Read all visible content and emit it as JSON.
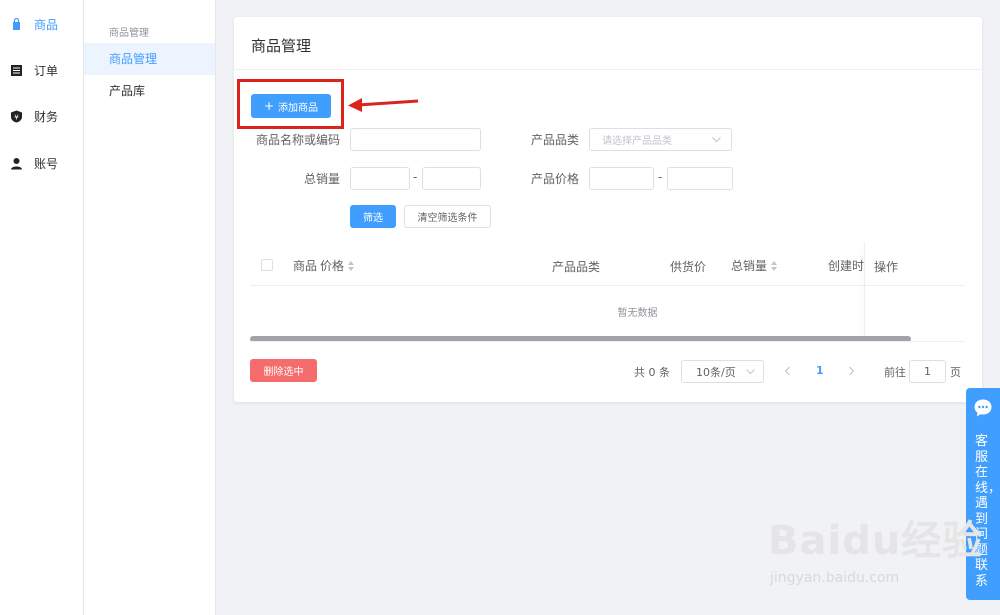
{
  "nav": {
    "items": [
      {
        "label": "商品",
        "icon": "bag-icon"
      },
      {
        "label": "订单",
        "icon": "list-icon"
      },
      {
        "label": "财务",
        "icon": "money-icon"
      },
      {
        "label": "账号",
        "icon": "user-icon"
      }
    ]
  },
  "subnav": {
    "group": "商品管理",
    "items": [
      "商品管理",
      "产品库"
    ]
  },
  "page": {
    "title": "商品管理",
    "add_button": "添加商品"
  },
  "filters": {
    "name_label": "商品名称或编码",
    "name_value": "",
    "category_label": "产品品类",
    "category_placeholder": "请选择产品品类",
    "sales_label": "总销量",
    "price_label": "产品价格",
    "dash": "-",
    "filter_button": "筛选",
    "clear_button": "清空筛选条件"
  },
  "table": {
    "columns": [
      "商品",
      "价格",
      "产品品类",
      "供货价",
      "总销量",
      "创建时间",
      "操作"
    ],
    "empty_text": "暂无数据"
  },
  "footer": {
    "delete_button": "删除选中",
    "total": "共 0 条",
    "page_size": "10条/页",
    "current_page": "1",
    "goto_label": "前往",
    "goto_value": "1",
    "page_suffix": "页"
  },
  "service": {
    "text": "客服在线，遇到问题联系"
  },
  "watermark": {
    "brand": "Baidu经验",
    "url": "jingyan.baidu.com"
  },
  "colors": {
    "accent": "#409eff",
    "danger": "#f56c6c",
    "highlight": "#d9251c"
  }
}
